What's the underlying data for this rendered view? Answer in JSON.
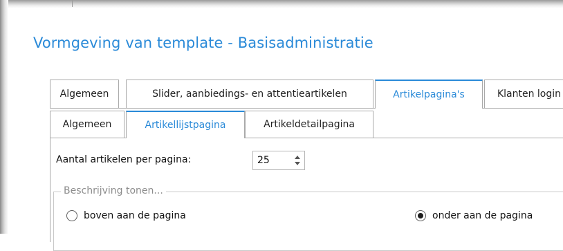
{
  "window": {
    "title": "Vormgeving van template - Basisadministratie"
  },
  "tabs": [
    {
      "label": "Algemeen",
      "active": false
    },
    {
      "label": "Slider, aanbiedings- en attentieartikelen",
      "active": false
    },
    {
      "label": "Artikelpagina's",
      "active": true
    },
    {
      "label": "Klanten login",
      "active": false
    }
  ],
  "subtabs": [
    {
      "label": "Algemeen",
      "active": false
    },
    {
      "label": "Artikellijstpagina",
      "active": true
    },
    {
      "label": "Artikeldetailpagina",
      "active": false
    }
  ],
  "articles_per_page": {
    "label": "Aantal artikelen per pagina:",
    "value": "25"
  },
  "description_group": {
    "legend": "Beschrijving tonen...",
    "options": [
      {
        "label": "boven aan de pagina",
        "checked": false
      },
      {
        "label": "onder aan de pagina",
        "checked": true
      }
    ]
  },
  "colors": {
    "accent": "#2a8ad8",
    "border": "#a9a9a9"
  }
}
